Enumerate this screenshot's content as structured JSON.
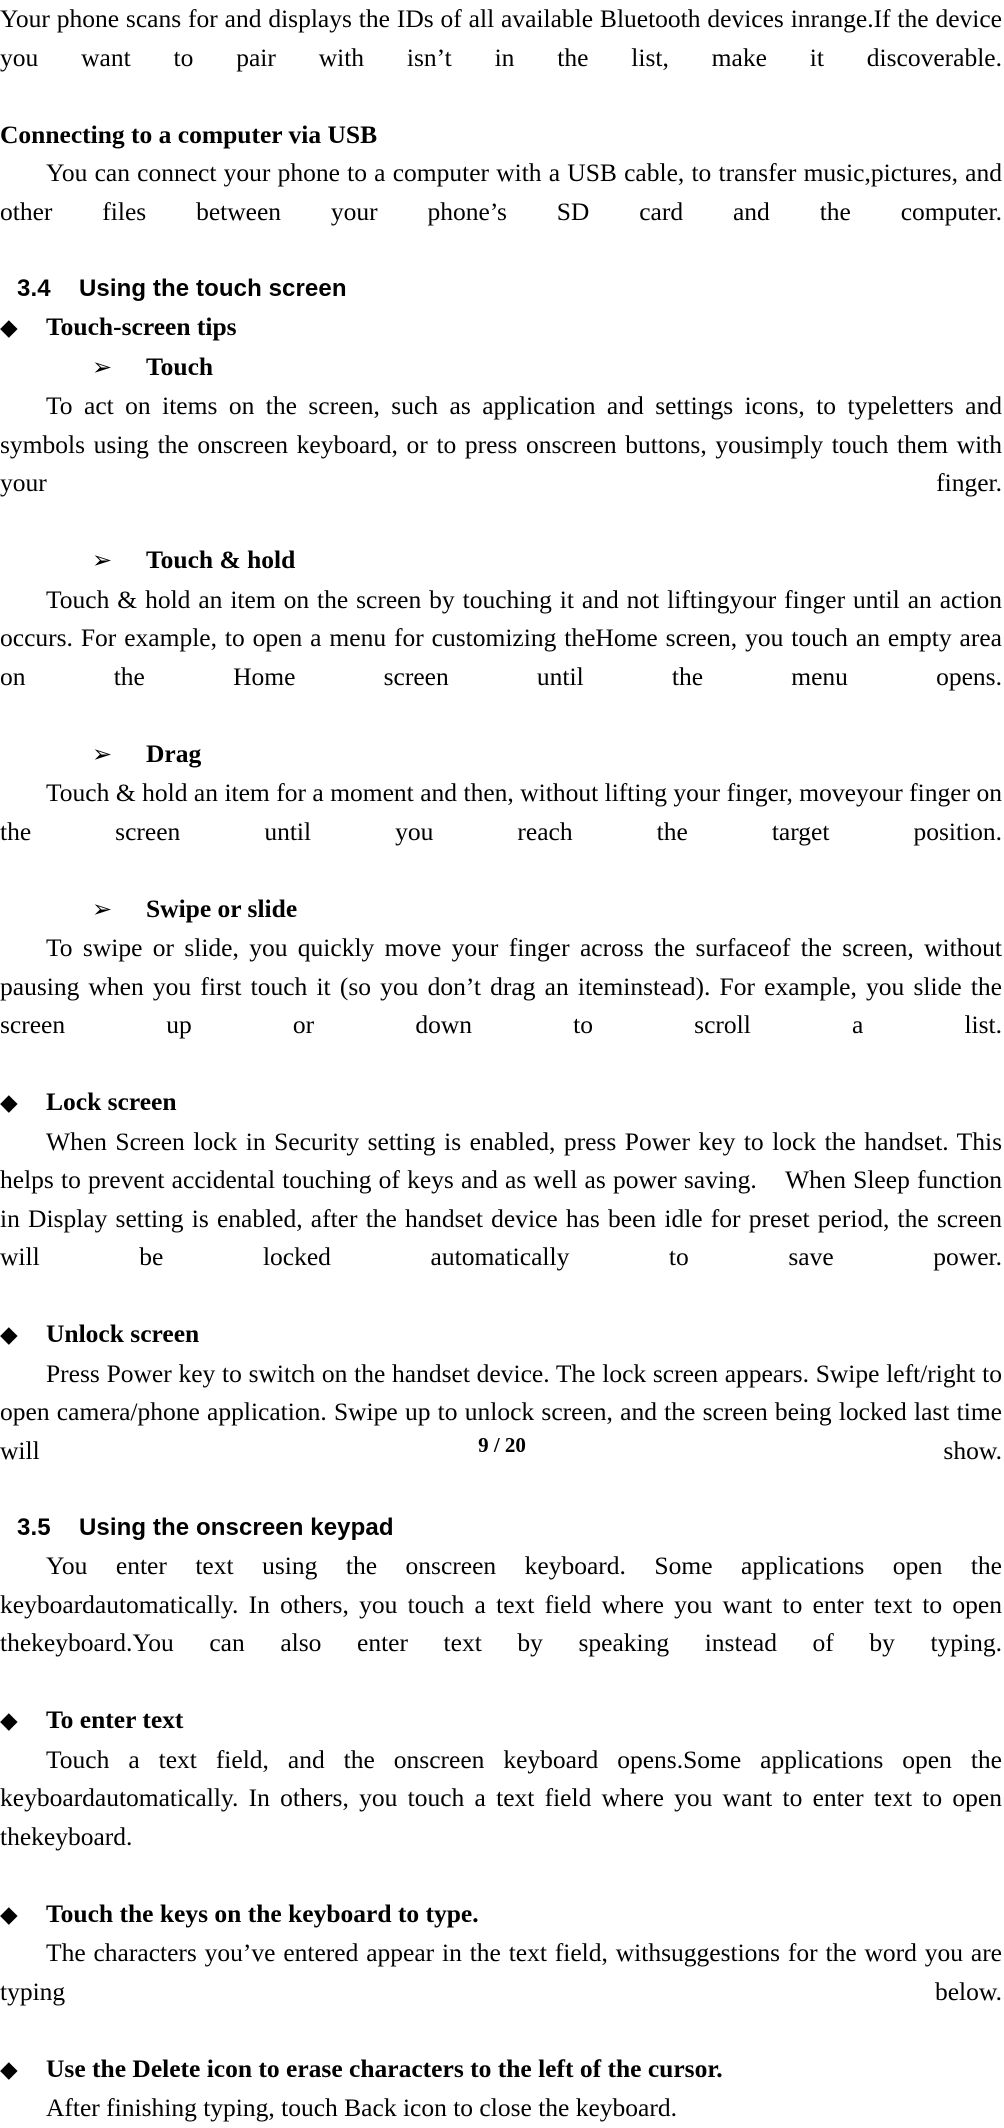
{
  "document": {
    "type": "user-manual-page",
    "page_footer": "9 / 20"
  },
  "blocks": {
    "intro_para": "Your phone scans for and displays the IDs of all available Bluetooth devices inrange.If the device you want to pair with isn’t in the list, make it discoverable.",
    "usb_heading": "Connecting to a computer via USB",
    "usb_para": "You can connect your phone to a computer with a USB cable, to transfer music,pictures, and other files between your phone’s SD card and the computer.",
    "section_34_num": "3.4",
    "section_34_title": "Using the touch screen",
    "touch_tips_bullet": "Touch-screen tips",
    "touch_sub": "Touch",
    "touch_para": "To act on items on the screen, such as application and settings icons, to typeletters and symbols using the onscreen keyboard, or to press onscreen buttons, yousimply touch them with your finger.",
    "touchhold_sub": "Touch & hold",
    "touchhold_para": "Touch & hold an item on the screen by touching it and not liftingyour finger until an action occurs. For example, to open a menu for customizing theHome screen, you touch an empty area on the Home screen until the menu opens.",
    "drag_sub": "Drag",
    "drag_para": "Touch & hold an item for a moment and then, without lifting your finger, moveyour finger on the screen until you reach the target position.",
    "swipe_sub": "Swipe or slide",
    "swipe_para": "To swipe or slide, you quickly move your finger across the surfaceof the screen, without pausing when you first touch it (so you don’t drag an iteminstead). For example, you slide the screen up or down to scroll a list.",
    "lock_bullet": "Lock screen",
    "lock_para": "When Screen lock in Security setting is enabled, press Power key to lock the handset. This helps to prevent accidental touching of keys and as well as power saving.    When Sleep function in Display setting is enabled, after the handset device has been idle for preset period, the screen will be locked automatically to save power.",
    "unlock_bullet": "Unlock screen",
    "unlock_para": "Press Power key to switch on the handset device. The lock screen appears. Swipe left/right to open camera/phone application. Swipe up to unlock screen, and the screen being locked last time will show.",
    "section_35_num": "3.5",
    "section_35_title": "Using the onscreen keypad",
    "keypad_para": "You enter text using the onscreen keyboard. Some applications open the keyboardautomatically. In others, you touch a text field where you want to enter text to open thekeyboard.You can also enter text by speaking instead of by typing.",
    "enter_text_bullet": "To enter text",
    "enter_text_para": "Touch a text field, and the onscreen keyboard opens.Some applications open the keyboardautomatically. In others, you touch a text field where you want to enter text to open thekeyboard.",
    "touch_keys_bullet": "Touch the keys on the keyboard to type.",
    "touch_keys_para": "The characters you’ve entered appear in the text field, withsuggestions for the word you are typing below.",
    "delete_icon_bullet": "Use the Delete icon to erase characters to the left of the cursor.",
    "delete_icon_para": "After finishing typing, touch Back icon to close the keyboard."
  },
  "markers": {
    "diamond": "◆",
    "arrow": "➢"
  }
}
